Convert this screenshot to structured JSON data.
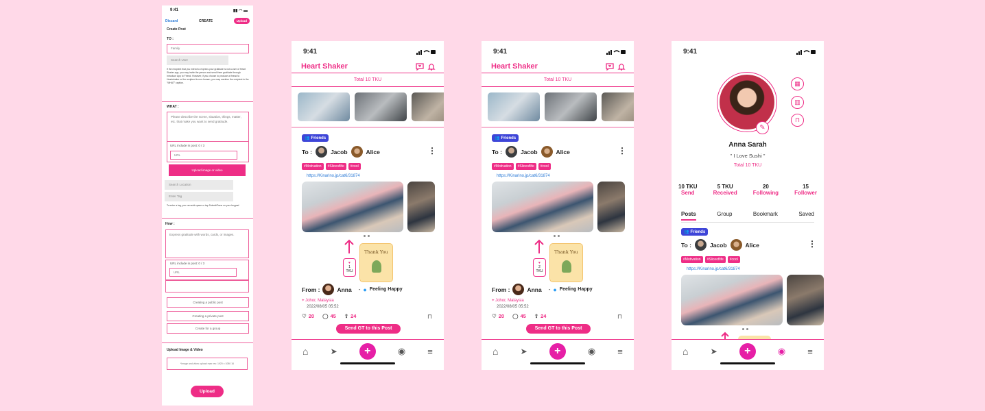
{
  "form": {
    "time": "9:41",
    "discard": "Discard",
    "title": "CREATE",
    "upload_btn": "Upload",
    "heading": "Create Post",
    "to_label": "TO :",
    "to_value": "Family",
    "search_user": "Search User",
    "to_note": "If the recipient that you intend to express your gratitude is not a user of Heart Shaker app, you may invite the person and send them gratitude through Introduce App to Friend. However, if you choose to produce a thread to Heartshaker or the recipient is non-human, you may mention the recipient in the \"WHAT\" caption.",
    "what_label": "WHAT :",
    "what_placeholder": "Please describe the scene, situation, things, matter, etc. that make you want to send gratitude.",
    "url_count_what": "URL include in post: 0 / 3",
    "url_placeholder": "URL",
    "upload_media_btn": "Upload image or video",
    "search_location": "Search Location",
    "enter_tag": "Enter Tag",
    "tag_note": "To enter a tag, you can add space or tap Submit/Done on your keypad",
    "how_label": "How :",
    "how_placeholder": "Express gratitude with words, cards, or images.",
    "url_count_how": "URL include in post: 0 / 3",
    "opt_public": "Creating a public post",
    "opt_private": "Creating a private post",
    "opt_group": "Create for a group",
    "upload_section": "Upload Image & Video",
    "upload_hint": "*Image and video upload max res: 1920 x 1080 16",
    "bottom_upload": "Upload"
  },
  "feed": {
    "time": "9:41",
    "app_title": "Heart Shaker",
    "total": "Total 10  TKU",
    "badge": "Friends",
    "to_label": "To :",
    "to_names": [
      "Jacob",
      "Alice"
    ],
    "tags": [
      "#Motivation",
      "#Sliceoflife",
      "#cool"
    ],
    "link": "https://Kinarino.jp/cat6/31874",
    "card_text": "Thank You",
    "tku_count_1": "1",
    "tku_count_2": "2",
    "tku_label": "TKU",
    "from_label": "From :",
    "from_name": "Anna",
    "feeling": "Feeling Happy",
    "location": "Johor, Malaysia",
    "date": "2022/08/05 05:52",
    "likes": "20",
    "comments": "45",
    "shares": "24",
    "send_btn": "Send GT to this Post"
  },
  "profile": {
    "time": "9:41",
    "name": "Anna Sarah",
    "bio": "\" I Love Sushi \"",
    "total": "Total 10  TKU",
    "stats": [
      {
        "value": "10 TKU",
        "label": "Send"
      },
      {
        "value": "5 TKU",
        "label": "Received"
      },
      {
        "value": "20",
        "label": "Following"
      },
      {
        "value": "15",
        "label": "Follower"
      }
    ],
    "tabs": [
      "Posts",
      "Group",
      "Bookmark",
      "Saved"
    ],
    "badge": "Friends",
    "to_label": "To :",
    "to_names": [
      "Jacob",
      "Alice"
    ],
    "tags": [
      "#Motivation",
      "#Sliceoflife",
      "#cool"
    ],
    "link": "https://Kinarino.jp/cat6/31874"
  },
  "icons": [
    "home-icon",
    "compass-icon",
    "plus-icon",
    "profile-icon",
    "menu-icon",
    "heart-chat-icon",
    "bell-icon",
    "qr-icon",
    "chart-icon",
    "bookmark-icon",
    "edit-icon"
  ],
  "colors": {
    "accent": "#ee2d86",
    "badge": "#3e45d8",
    "background": "#ffd9e8",
    "link": "#2a79d6"
  }
}
